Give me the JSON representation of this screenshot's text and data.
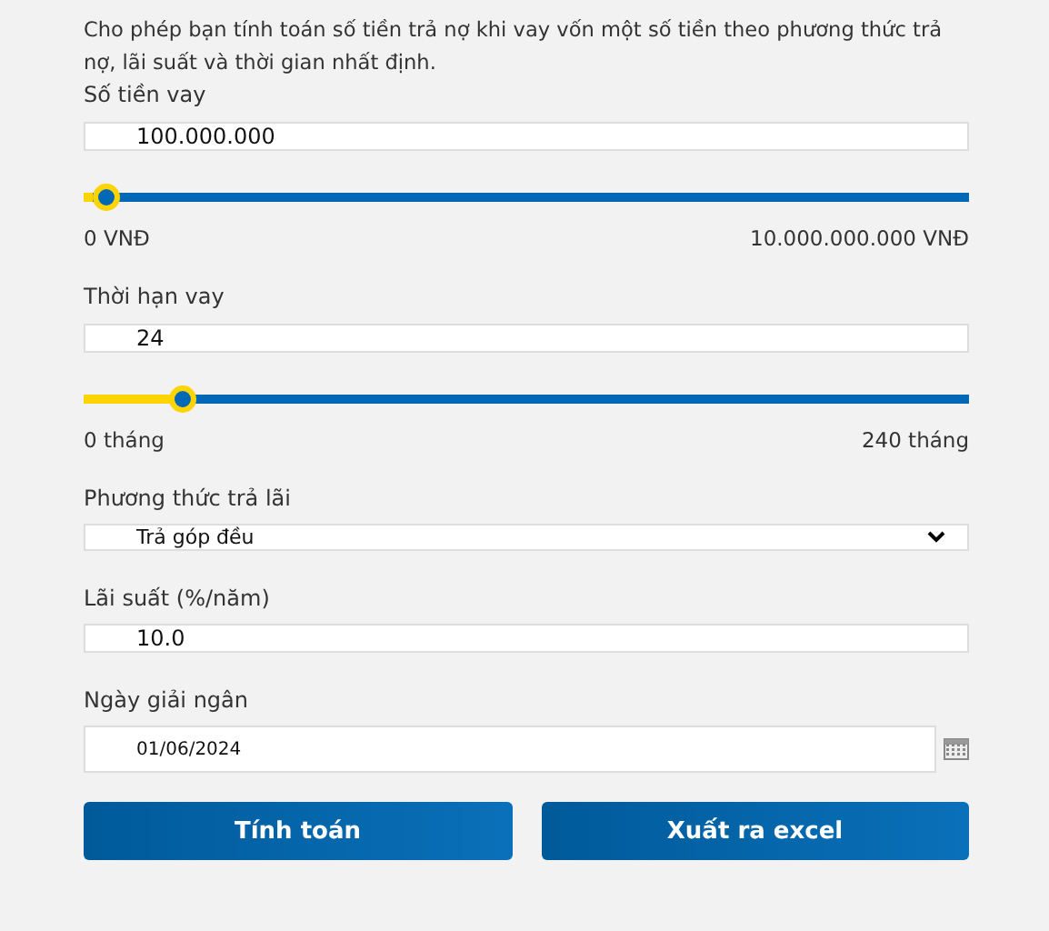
{
  "description": "Cho phép bạn tính toán số tiền trả nợ khi vay vốn một số tiền theo phương thức trả nợ, lãi suất và thời gian nhất định.",
  "fields": [
    {
      "kind": "slider",
      "label": "Số tiền vay",
      "value": "100.000.000",
      "level": 0.01,
      "min_label": "0 VNĐ",
      "max_label": "10.000.000.000 VNĐ"
    },
    {
      "kind": "slider",
      "label": "Thời hạn vay",
      "value": "24",
      "level": 0.1,
      "min_label": "0 tháng",
      "max_label": "240 tháng"
    },
    {
      "kind": "select",
      "label": "Phương thức trả lãi",
      "value": "Trả góp đều"
    },
    {
      "kind": "text",
      "label": "Lãi suất (%/năm)",
      "value": "10.0"
    },
    {
      "kind": "date",
      "label": "Ngày giải ngân",
      "value": "01/06/2024"
    }
  ],
  "buttons": [
    "Tính toán",
    "Xuất ra excel"
  ]
}
